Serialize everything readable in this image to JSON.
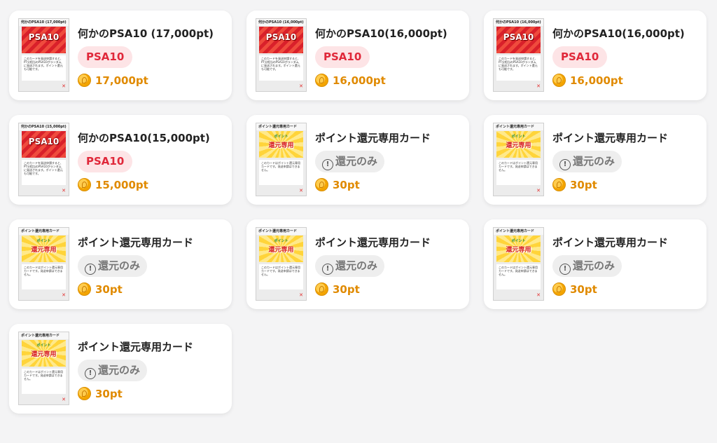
{
  "colors": {
    "psa_badge_bg": "#fde4e6",
    "psa_badge_text": "#e0283a",
    "return_badge_bg": "#eeeeee",
    "return_badge_text": "#777777",
    "price_text": "#e08a00"
  },
  "cards": [
    {
      "title": "何かのPSA10 (17,000pt)",
      "badge": "PSA10",
      "badge_type": "psa",
      "price": "17,000pt",
      "thumb_header": "何かのPSA10 (17,000pt)",
      "thumb_art": "PSA10",
      "thumb_body": "このカードを発送申請すると、PT分相当のPSA10がランダムに発送されます。ポイント還元も可能です。"
    },
    {
      "title": "何かのPSA10(16,000pt)",
      "badge": "PSA10",
      "badge_type": "psa",
      "price": "16,000pt",
      "thumb_header": "何かのPSA10 (16,000pt)",
      "thumb_art": "PSA10",
      "thumb_body": "このカードを発送申請すると、PT分相当のPSA10がランダムに発送されます。ポイント還元も可能です。"
    },
    {
      "title": "何かのPSA10(16,000pt)",
      "badge": "PSA10",
      "badge_type": "psa",
      "price": "16,000pt",
      "thumb_header": "何かのPSA10 (16,000pt)",
      "thumb_art": "PSA10",
      "thumb_body": "このカードを発送申請すると、PT分相当のPSA10がランダムに発送されます。ポイント還元も可能です。"
    },
    {
      "title": "何かのPSA10(15,000pt)",
      "badge": "PSA10",
      "badge_type": "psa",
      "price": "15,000pt",
      "thumb_header": "何かのPSA10 (15,000pt)",
      "thumb_art": "PSA10",
      "thumb_body": "このカードを発送申請すると、PT分相当のPSA10がランダムに発送されます。ポイント還元も可能です。"
    },
    {
      "title": "ポイント還元専用カード",
      "badge": "還元のみ",
      "badge_type": "return",
      "price": "30pt",
      "thumb_header": "ポイント還元専用カード",
      "thumb_art": "還元専用",
      "thumb_sub": "ポイント",
      "thumb_body": "このカードはポイント還元専用カードです。発送申請はできません。"
    },
    {
      "title": "ポイント還元専用カード",
      "badge": "還元のみ",
      "badge_type": "return",
      "price": "30pt",
      "thumb_header": "ポイント還元専用カード",
      "thumb_art": "還元専用",
      "thumb_sub": "ポイント",
      "thumb_body": "このカードはポイント還元専用カードです。発送申請はできません。"
    },
    {
      "title": "ポイント還元専用カード",
      "badge": "還元のみ",
      "badge_type": "return",
      "price": "30pt",
      "thumb_header": "ポイント還元専用カード",
      "thumb_art": "還元専用",
      "thumb_sub": "ポイント",
      "thumb_body": "このカードはポイント還元専用カードです。発送申請はできません。"
    },
    {
      "title": "ポイント還元専用カード",
      "badge": "還元のみ",
      "badge_type": "return",
      "price": "30pt",
      "thumb_header": "ポイント還元専用カード",
      "thumb_art": "還元専用",
      "thumb_sub": "ポイント",
      "thumb_body": "このカードはポイント還元専用カードです。発送申請はできません。"
    },
    {
      "title": "ポイント還元専用カード",
      "badge": "還元のみ",
      "badge_type": "return",
      "price": "30pt",
      "thumb_header": "ポイント還元専用カード",
      "thumb_art": "還元専用",
      "thumb_sub": "ポイント",
      "thumb_body": "このカードはポイント還元専用カードです。発送申請はできません。"
    },
    {
      "title": "ポイント還元専用カード",
      "badge": "還元のみ",
      "badge_type": "return",
      "price": "30pt",
      "thumb_header": "ポイント還元専用カード",
      "thumb_art": "還元専用",
      "thumb_sub": "ポイント",
      "thumb_body": "このカードはポイント還元専用カードです。発送申請はできません。"
    }
  ]
}
